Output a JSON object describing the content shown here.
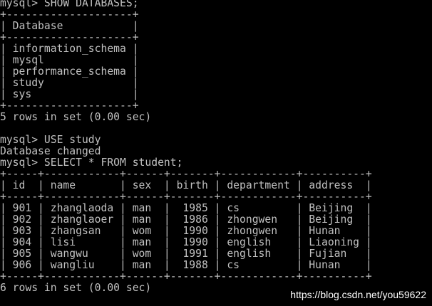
{
  "terminal": {
    "lines": [
      "mysql> SHOW DATABASES;",
      "+--------------------+",
      "| Database           |",
      "+--------------------+",
      "| information_schema |",
      "| mysql              |",
      "| performance_schema |",
      "| study              |",
      "| sys                |",
      "+--------------------+",
      "5 rows in set (0.00 sec)",
      "",
      "mysql> USE study",
      "Database changed",
      "mysql> SELECT * FROM student;",
      "+-----+------------+------+-------+------------+----------+",
      "| id  | name       | sex  | birth | department | address  |",
      "+-----+------------+------+-------+------------+----------+",
      "| 901 | zhanglaoda | man  |  1985 | cs         | Beijing  |",
      "| 902 | zhanglaoer | man  |  1986 | zhongwen   | Beijing  |",
      "| 903 | zhangsan   | wom  |  1990 | zhongwen   | Hunan    |",
      "| 904 | lisi       | man  |  1990 | english    | Liaoning |",
      "| 905 | wangwu     | wom  |  1991 | english    | Fujian   |",
      "| 906 | wangliu    | man  |  1988 | cs         | Hunan    |",
      "+-----+------------+------+-------+------------+----------+",
      "6 rows in set (0.00 sec)",
      "",
      ""
    ]
  },
  "watermark": "https://blog.csdn.net/you59622",
  "colors": {
    "background": "#000000",
    "text": "#c0c0c0",
    "watermark": "#ffffff"
  }
}
